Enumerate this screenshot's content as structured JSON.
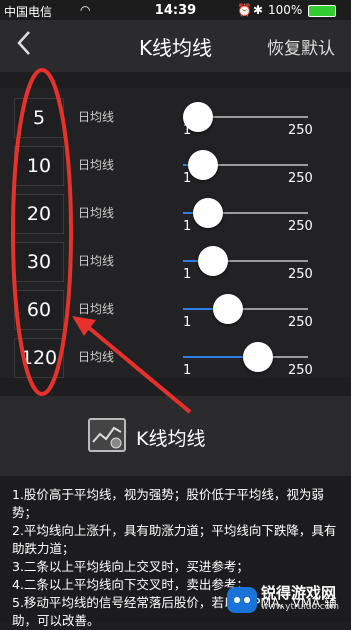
{
  "status_bar": {
    "carrier": "中国电信",
    "time": "14:39",
    "battery": "100%"
  },
  "nav": {
    "back_icon": "chevron-left-icon",
    "title": "K线均线",
    "reset_label": "恢复默认"
  },
  "rows": [
    {
      "value": "5",
      "label": "日均线",
      "min": "1",
      "max": "250",
      "position": 0.0
    },
    {
      "value": "10",
      "label": "日均线",
      "min": "1",
      "max": "250",
      "position": 0.04
    },
    {
      "value": "20",
      "label": "日均线",
      "min": "1",
      "max": "250",
      "position": 0.08
    },
    {
      "value": "30",
      "label": "日均线",
      "min": "1",
      "max": "250",
      "position": 0.12
    },
    {
      "value": "60",
      "label": "日均线",
      "min": "1",
      "max": "250",
      "position": 0.24
    },
    {
      "value": "120",
      "label": "日均线",
      "min": "1",
      "max": "250",
      "position": 0.48
    }
  ],
  "section": {
    "title": "K线均线",
    "icon": "line-chart-icon"
  },
  "description": {
    "line1": "1.股价高于平均线，视为强势；股价低于平均线，视为弱势；",
    "line2": "2.平均线向上涨升，具有助涨力道；平均线向下跌降，具有助跌力道；",
    "line3": "3.二条以上平均线向上交叉时，买进参考；",
    "line4": "4.二条以上平均线向下交叉时，卖出参考；",
    "line5": "5.移动平均线的信号经常落后股价，若以EXPMA、VMA 辅助，可以改善。"
  },
  "watermark": {
    "text": "锐得游戏网",
    "url": "www.ytruido.com"
  },
  "colors": {
    "accent": "#2f7fe8",
    "annotation": "#e8312c"
  }
}
